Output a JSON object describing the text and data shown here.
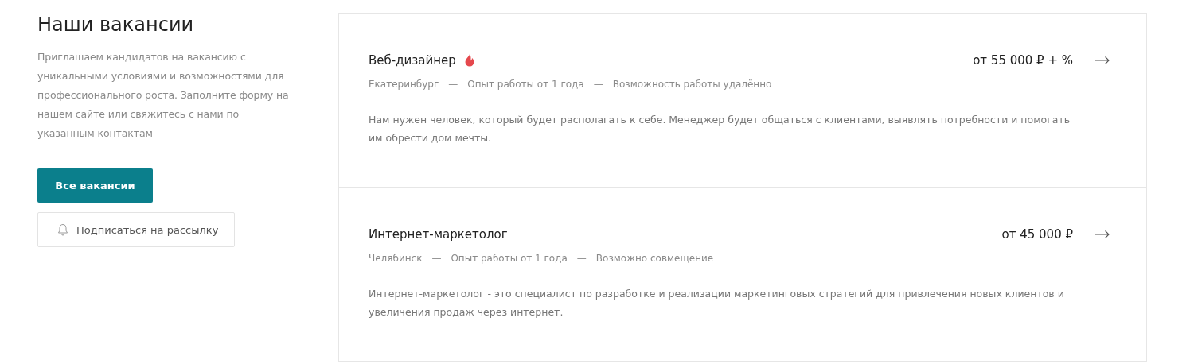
{
  "intro": {
    "title": "Наши вакансии",
    "text": "Приглашаем кандидатов на вакансию с уникальными условиями и возможностями для профессионального роста. Заполните форму на нашем сайте или свяжитесь с нами по указанным контактам",
    "primary_button": "Все вакансии",
    "subscribe_button": "Подписаться на рассылку"
  },
  "vacancies": [
    {
      "title": "Веб-дизайнер",
      "hot": true,
      "salary": "от 55 000 ₽ + %",
      "meta": [
        "Екатеринбург",
        "Опыт работы от 1 года",
        "Возможность работы удалённо"
      ],
      "separators": [
        "—",
        "—"
      ],
      "description": "Нам нужен человек, который будет располагать к себе. Менеджер будет общаться с клиентами, выявлять потребности и помогать им обрести дом мечты."
    },
    {
      "title": "Интернет-маркетолог",
      "hot": false,
      "salary": "от 45 000 ₽",
      "meta": [
        "Челябинск",
        "Опыт работы от 1 года",
        "Возможно совмещение"
      ],
      "separators": [
        "—",
        "—"
      ],
      "description": "Интернет-маркетолог - это специалист по разработке и реализации маркетинговых стратегий для привлечения новых клиентов и увеличения продаж через интернет."
    }
  ]
}
